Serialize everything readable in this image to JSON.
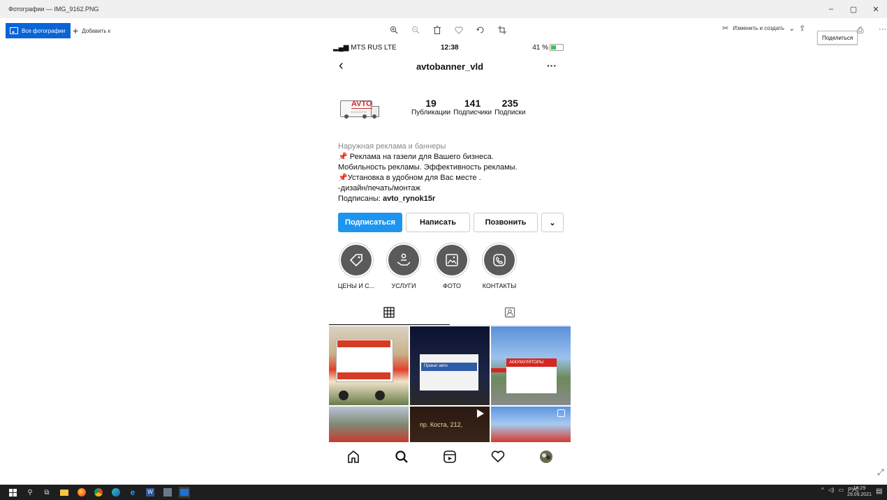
{
  "window": {
    "title": "Фотографии — IMG_9162.PNG",
    "controls": [
      "–",
      "▢",
      "✕"
    ]
  },
  "toolbar": {
    "all_photos": "Все фотографии",
    "add": "Добавить к",
    "edit_create": "Изменить и создать",
    "share_tooltip": "Поделиться"
  },
  "phone": {
    "status": {
      "carrier": "MTS RUS  LTE",
      "time": "12:38",
      "battery": "41 %"
    },
    "username": "avtobanner_vld",
    "avatar_logo": "AVTO",
    "avatar_sub": "BANNER",
    "stats": [
      {
        "value": "19",
        "label": "Публикации"
      },
      {
        "value": "141",
        "label": "Подписчики"
      },
      {
        "value": "235",
        "label": "Подписки"
      }
    ],
    "bio": {
      "category": "Наружная реклама и баннеры",
      "line1": "Реклама на газели для Вашего бизнеса.",
      "line2": "Мобильность рекламы. Эффективность рекламы.",
      "line3": "Установка в удобном для Вас месте .",
      "line4": "-дизайн/печать/монтаж",
      "followed_prefix": "Подписаны: ",
      "followed_user": "avto_rynok15r"
    },
    "actions": {
      "follow": "Подписаться",
      "message": "Написать",
      "call": "Позвонить",
      "more": "⌄"
    },
    "highlights": [
      {
        "label": "ЦЕНЫ И С...",
        "icon": "tag-icon"
      },
      {
        "label": "УСЛУГИ",
        "icon": "hand-user-icon"
      },
      {
        "label": "ФОТО",
        "icon": "image-icon"
      },
      {
        "label": "КОНТАКТЫ",
        "icon": "phone-icon"
      }
    ],
    "grid_signs": [
      "Прокат авто",
      "АККУМУЛЯТОРЫ",
      "пр. Коста, 212,"
    ]
  },
  "taskbar": {
    "lang": "РУС",
    "time": "16:29",
    "date": "29.09.2021"
  }
}
